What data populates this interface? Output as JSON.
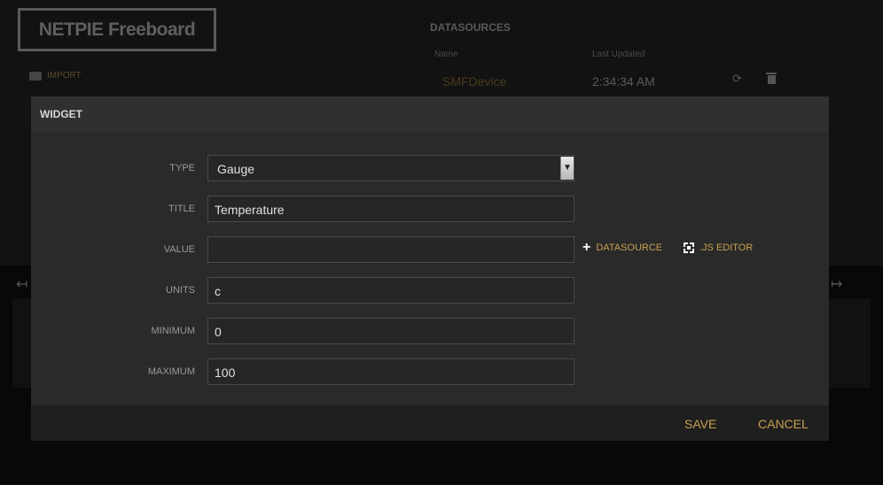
{
  "app": {
    "logo": "NETPIE Freeboard",
    "import_label": "IMPORT"
  },
  "datasources": {
    "title": "DATASOURCES",
    "columns": [
      "Name",
      "Last Updated"
    ],
    "rows": [
      {
        "name": "SMFDevice",
        "last_updated": "2:34:34 AM",
        "icons": [
          "refresh-icon",
          "trash-icon"
        ]
      }
    ]
  },
  "modal": {
    "title": "WIDGET",
    "fields": {
      "type": {
        "label": "TYPE",
        "value": "Gauge"
      },
      "title": {
        "label": "TITLE",
        "value": "Temperature"
      },
      "value": {
        "label": "VALUE",
        "value": ""
      },
      "units": {
        "label": "UNITS",
        "value": "c"
      },
      "minimum": {
        "label": "MINIMUM",
        "value": "0"
      },
      "maximum": {
        "label": "MAXIMUM",
        "value": "100"
      }
    },
    "value_actions": {
      "datasource": "DATASOURCE",
      "js_editor": ".JS EDITOR"
    },
    "buttons": {
      "save": "SAVE",
      "cancel": "CANCEL"
    }
  },
  "colors": {
    "accent": "#c8a050",
    "modal_bg": "#2a2a2a",
    "overlay": "#080808"
  }
}
